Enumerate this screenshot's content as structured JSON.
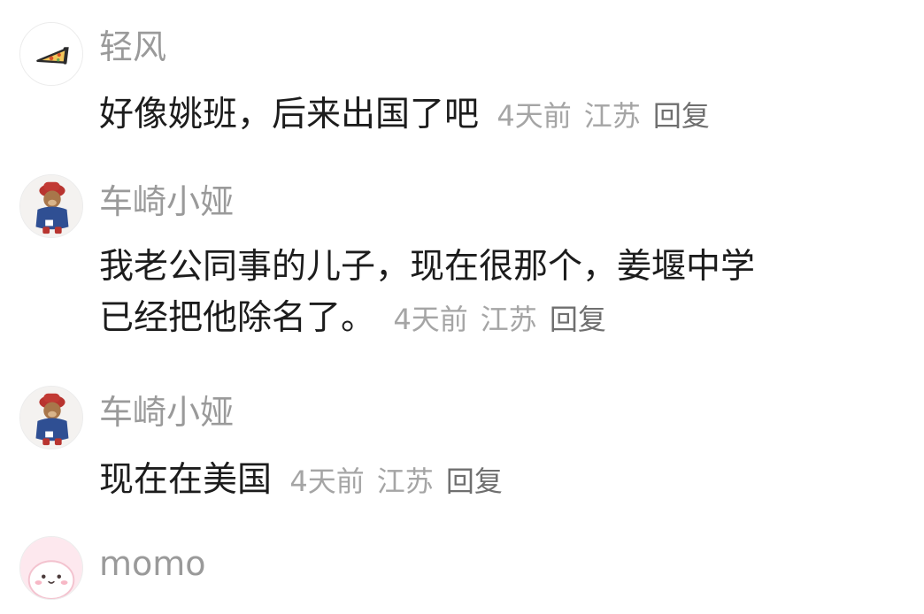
{
  "comments": [
    {
      "avatar_icon": "pizza-icon",
      "username": "轻风",
      "text_lines": [
        "好像姚班，后来出国了吧"
      ],
      "time": "4天前",
      "location": "江苏",
      "reply_label": "回复"
    },
    {
      "avatar_icon": "bear-doll-avatar",
      "username": "车崎小娅",
      "text_lines": [
        "我老公同事的儿子，现在很那个，姜堰中学",
        "已经把他除名了。"
      ],
      "time": "4天前",
      "location": "江苏",
      "reply_label": "回复"
    },
    {
      "avatar_icon": "bear-doll-avatar",
      "username": "车崎小娅",
      "text_lines": [
        "现在在美国"
      ],
      "time": "4天前",
      "location": "江苏",
      "reply_label": "回复"
    },
    {
      "avatar_icon": "pink-bunny-avatar",
      "username": "momo",
      "text_lines": [],
      "time": "",
      "location": "",
      "reply_label": ""
    }
  ]
}
